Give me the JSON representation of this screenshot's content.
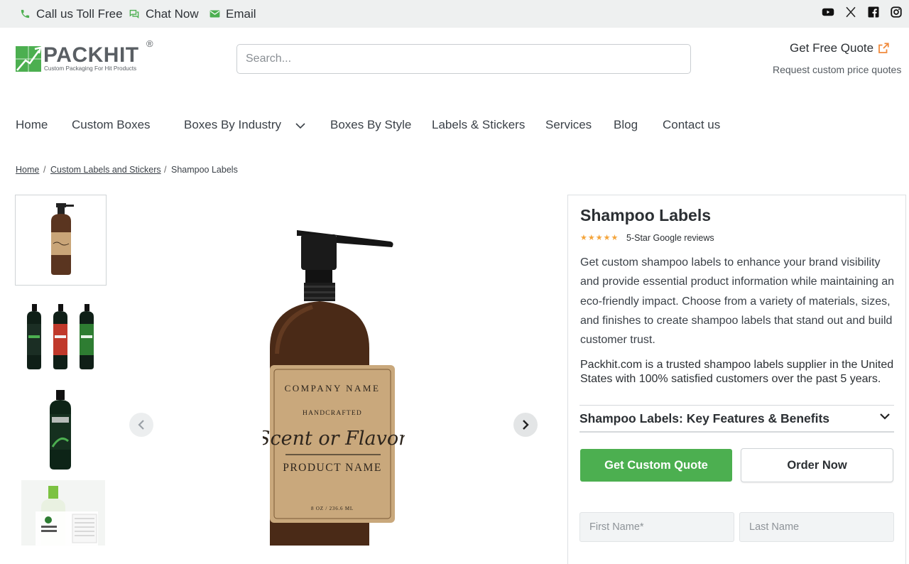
{
  "topbar": {
    "call": "Call us Toll Free",
    "chat": "Chat Now",
    "email": "Email",
    "social": [
      "youtube-icon",
      "x-icon",
      "facebook-icon",
      "instagram-icon"
    ]
  },
  "brand": {
    "name": "PACKHIT",
    "tagline": "Custom Packaging For Hit Products",
    "registered": "®",
    "green": "#4caf50"
  },
  "search": {
    "placeholder": "Search..."
  },
  "quote": {
    "label": "Get Free Quote",
    "sub": "Request custom price quotes",
    "icon_color": "#f08a3c"
  },
  "nav": {
    "home": "Home",
    "custom_boxes": "Custom Boxes",
    "by_industry": "Boxes By Industry",
    "by_style": "Boxes By Style",
    "labels": "Labels & Stickers",
    "services": "Services",
    "blog": "Blog",
    "contact": "Contact us"
  },
  "breadcrumb": {
    "home": "Home",
    "category": "Custom Labels and Stickers",
    "current": "Shampoo Labels",
    "sep": "/"
  },
  "main_image": {
    "company": "COMPANY NAME",
    "handcrafted": "HANDCRAFTED",
    "scent": "Scent or Flavor",
    "product": "PRODUCT NAME",
    "size": "8 OZ / 236.6 ML"
  },
  "product": {
    "title": "Shampoo Labels",
    "stars": "★★★★★",
    "reviews": "5-Star Google reviews",
    "description": "Get custom shampoo labels to enhance your brand visibility and provide essential product information while maintaining an eco-friendly impact. Choose from a variety of materials, sizes, and finishes to create shampoo labels that stand out and build customer trust.",
    "trust": "Packhit.com is a trusted shampoo labels supplier in the United States with 100% satisfied customers over the past 5 years.",
    "features_label": "Shampoo Labels: Key Features & Benefits",
    "quote_button": "Get Custom Quote",
    "order_button": "Order Now",
    "first_name_placeholder": "First Name*",
    "last_name_placeholder": "Last Name"
  }
}
